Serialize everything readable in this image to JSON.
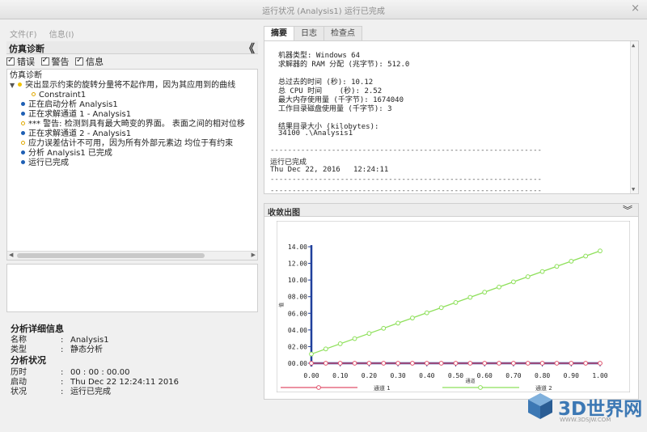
{
  "window": {
    "title": "运行状况 (Analysis1) 运行已完成",
    "close_glyph": "×"
  },
  "menu": {
    "file": "文件(F)",
    "info": "信息(I)"
  },
  "diagnostics": {
    "title": "仿真诊断",
    "collapse_glyph": "《",
    "filters": {
      "errors": "错误",
      "warnings": "警告",
      "info": "信息"
    },
    "tree_root": "仿真诊断",
    "tree_items": [
      {
        "text": "突出显示约束的旋转分量将不起作用，因为其应用到的曲线",
        "type": "warning"
      },
      {
        "text": "Constraint1",
        "type": "warning-child"
      },
      {
        "text": "正在启动分析 Analysis1",
        "type": "info"
      },
      {
        "text": "正在求解通道 1 - Analysis1",
        "type": "info"
      },
      {
        "text": "*** 警告: 检测到具有最大畸变的界面。 表面之间的相对位移",
        "type": "warning"
      },
      {
        "text": "正在求解通道 2 - Analysis1",
        "type": "info"
      },
      {
        "text": "应力误差估计不可用，因为所有外部元素边 均位于有约束",
        "type": "warning"
      },
      {
        "text": "分析 Analysis1 已完成",
        "type": "info"
      },
      {
        "text": "运行已完成",
        "type": "info"
      }
    ]
  },
  "details": {
    "title": "分析详细信息",
    "name_label": "名称",
    "name_value": "Analysis1",
    "type_label": "类型",
    "type_value": "静态分析",
    "status_title": "分析状况",
    "elapsed_label": "历时",
    "elapsed_value": "00 : 00 : 00.00",
    "start_label": "启动",
    "start_value": "Thu Dec 22 12:24:11 2016",
    "state_label": "状况",
    "state_value": "运行已完成",
    "colon": ":"
  },
  "tabs": {
    "summary": "摘要",
    "log": "日志",
    "checkpoint": "检查点"
  },
  "summary_lines": [
    "机器类型: Windows 64",
    "求解器的 RAM 分配 (兆字节): 512.0",
    "总过去的时间 (秒): 10.12",
    "总 CPU 时间    (秒): 2.52",
    "最大内存使用量 (千字节): 1674040",
    "工作目录磁盘使用量 (千字节): 3",
    "结果目录大小 (kilobytes):",
    "34100 .\\Analysis1",
    "--------------------------------------------------------------",
    "运行已完成",
    "Thu Dec 22, 2016   12:24:11",
    "--------------------------------------------------------------",
    "--------------------------------------------------------------"
  ],
  "chart_panel": {
    "title": "收敛出图",
    "toggle_glyph": "︾"
  },
  "chart_data": {
    "type": "line",
    "ylabel": "值",
    "xlabel": "通道",
    "xlim": [
      0,
      1
    ],
    "ylim": [
      0,
      14
    ],
    "x_ticks": [
      "0.00",
      "0.10",
      "0.20",
      "0.30",
      "0.40",
      "0.50",
      "0.60",
      "0.70",
      "0.80",
      "0.90",
      "1.00"
    ],
    "y_ticks": [
      "00.00",
      "02.00",
      "04.00",
      "06.00",
      "08.00",
      "10.00",
      "12.00",
      "14.00"
    ],
    "x": [
      0.0,
      0.05,
      0.1,
      0.15,
      0.2,
      0.25,
      0.3,
      0.35,
      0.4,
      0.45,
      0.5,
      0.55,
      0.6,
      0.65,
      0.7,
      0.75,
      0.8,
      0.85,
      0.9,
      0.95,
      1.0
    ],
    "series": [
      {
        "name": "通道 1",
        "color": "#e0506a",
        "values": [
          0,
          0,
          0,
          0,
          0,
          0,
          0,
          0,
          0,
          0,
          0,
          0,
          0,
          0,
          0,
          0,
          0,
          0,
          0,
          0,
          0
        ]
      },
      {
        "name": "通道 2",
        "color": "#8ee05a",
        "values": [
          1.1,
          1.72,
          2.34,
          2.96,
          3.58,
          4.2,
          4.82,
          5.44,
          6.06,
          6.68,
          7.3,
          7.92,
          8.54,
          9.16,
          9.78,
          10.4,
          11.02,
          11.64,
          12.26,
          12.88,
          13.5
        ]
      }
    ]
  },
  "watermark": {
    "brand": "3D世界网",
    "url": "WWW.3DSJW.COM"
  }
}
